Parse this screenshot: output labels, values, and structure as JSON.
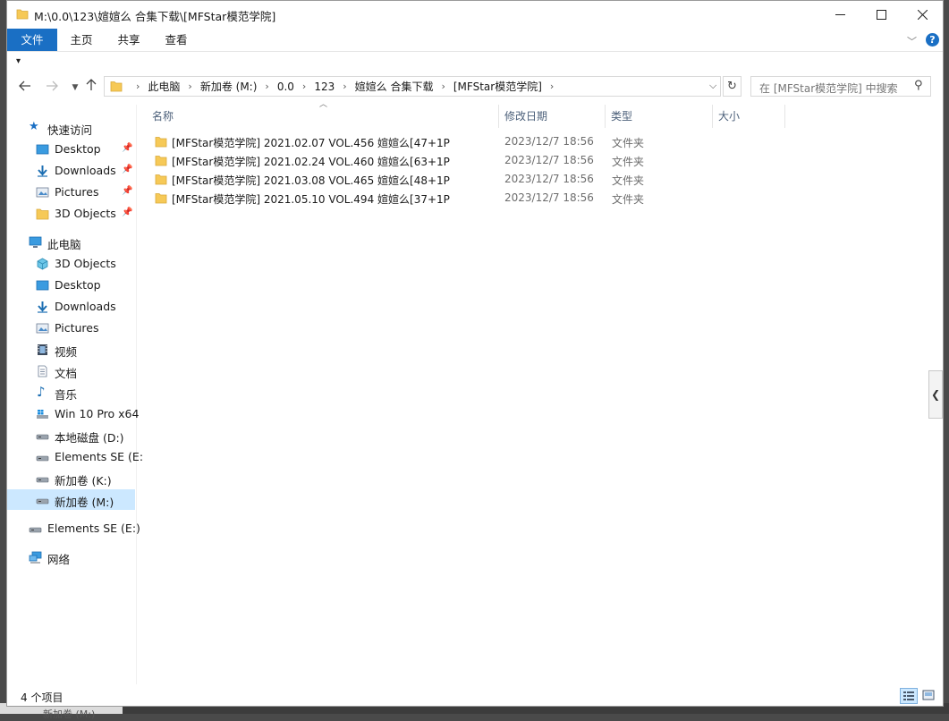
{
  "window": {
    "title": "M:\\0.0\\123\\媗媗么 合集下载\\[MFStar模范学院]"
  },
  "ribbon": {
    "tabs": [
      "文件",
      "主页",
      "共享",
      "查看"
    ]
  },
  "address": {
    "crumbs": [
      "此电脑",
      "新加卷 (M:)",
      "0.0",
      "123",
      "媗媗么 合集下载",
      "[MFStar模范学院]"
    ]
  },
  "search": {
    "placeholder": "在 [MFStar模范学院] 中搜索"
  },
  "sidebar": {
    "quick_access": "快速访问",
    "quick_items": [
      "Desktop",
      "Downloads",
      "Pictures",
      "3D Objects"
    ],
    "this_pc": "此电脑",
    "pc_items": [
      "3D Objects",
      "Desktop",
      "Downloads",
      "Pictures",
      "视频",
      "文档",
      "音乐",
      "Win 10 Pro x64",
      "本地磁盘 (D:)",
      "Elements SE (E:",
      "新加卷 (K:)",
      "新加卷 (M:)"
    ],
    "elements": "Elements SE (E:)",
    "network": "网络"
  },
  "columns": {
    "name": "名称",
    "date": "修改日期",
    "type": "类型",
    "size": "大小"
  },
  "files": [
    {
      "name": "[MFStar模范学院] 2021.02.07 VOL.456 媗媗么[47+1P",
      "date": "2023/12/7 18:56",
      "type": "文件夹"
    },
    {
      "name": "[MFStar模范学院] 2021.02.24 VOL.460 媗媗么[63+1P",
      "date": "2023/12/7 18:56",
      "type": "文件夹"
    },
    {
      "name": "[MFStar模范学院] 2021.03.08 VOL.465 媗媗么[48+1P",
      "date": "2023/12/7 18:56",
      "type": "文件夹"
    },
    {
      "name": "[MFStar模范学院] 2021.05.10 VOL.494 媗媗么[37+1P",
      "date": "2023/12/7 18:56",
      "type": "文件夹"
    }
  ],
  "status": {
    "count": "4 个项目"
  },
  "background": {
    "ghost_label": "新加卷 (M:)"
  },
  "colors": {
    "accent": "#1a6fc4",
    "folder": "#f6c957",
    "selection": "#cce8ff"
  }
}
